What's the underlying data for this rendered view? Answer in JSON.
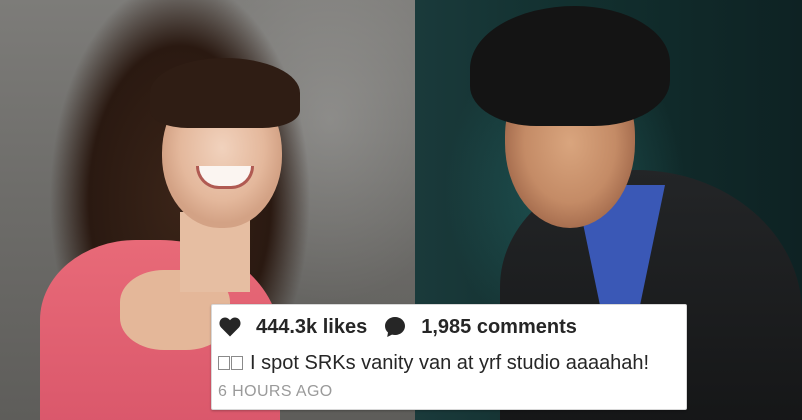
{
  "post": {
    "likes_label": "444.3k likes",
    "comments_label": "1,985 comments",
    "caption": "I spot SRKs vanity van at yrf studio aaaahah!",
    "timestamp": "6 HOURS AGO"
  },
  "icons": {
    "like": "heart-icon",
    "comment": "comment-bubble-icon",
    "caption_emoji": "missing-glyph-emoji-icon"
  },
  "colors": {
    "card_background": "#ffffff",
    "text_primary": "#262626",
    "text_secondary": "#9a9a9a",
    "left_photo_background": "#6e6d6a",
    "right_photo_background": "#12302f",
    "dress": "#d9566a"
  }
}
